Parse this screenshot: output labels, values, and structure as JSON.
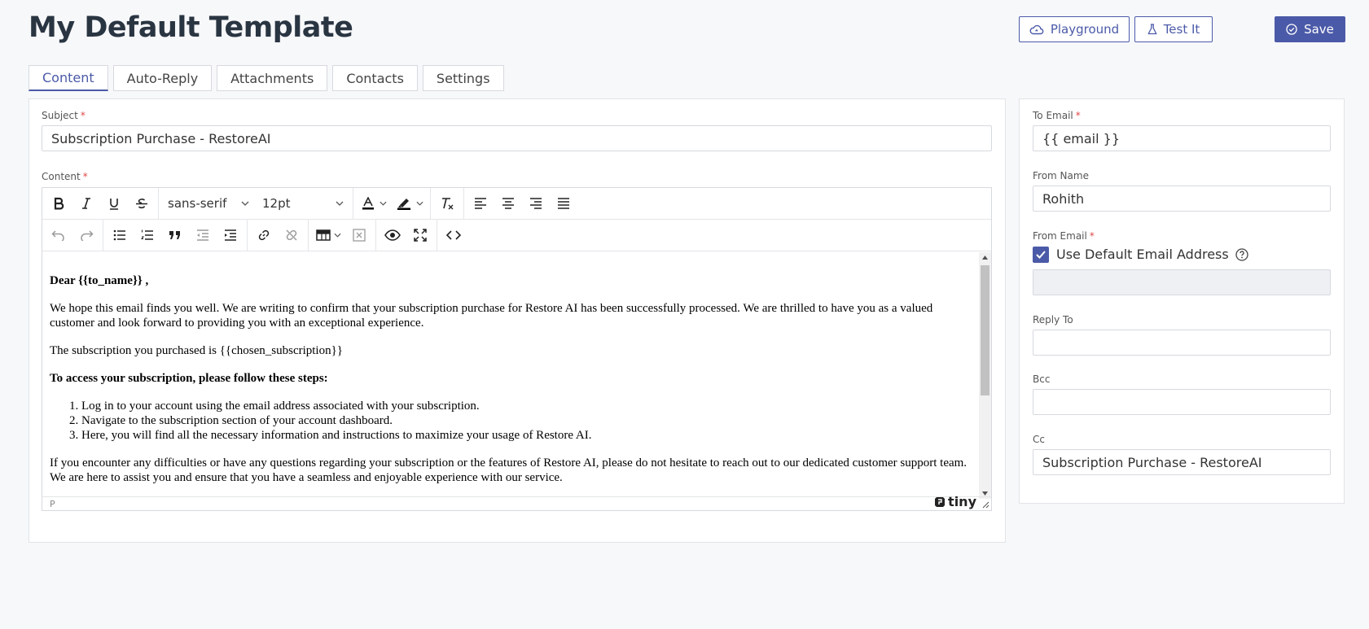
{
  "header": {
    "title": "My Default Template",
    "playground_label": "Playground",
    "test_label": "Test It",
    "save_label": "Save"
  },
  "tabs": [
    {
      "label": "Content",
      "active": true
    },
    {
      "label": "Auto-Reply"
    },
    {
      "label": "Attachments"
    },
    {
      "label": "Contacts"
    },
    {
      "label": "Settings"
    }
  ],
  "content": {
    "subject_label": "Subject",
    "subject_value": "Subscription Purchase - RestoreAI",
    "content_label": "Content"
  },
  "editor": {
    "font_family": "sans-serif",
    "font_size": "12pt",
    "status_path": "P",
    "brand": "tiny",
    "body": {
      "greeting": "Dear {{to_name}} ,",
      "para1": "We hope this email finds you well. We are writing to confirm that your subscription purchase for Restore AI has been successfully processed. We are thrilled to have you as a valued customer and look forward to providing you with an exceptional experience.",
      "para2": "The subscription you purchased is {{chosen_subscription}}",
      "steps_heading": "To access your subscription, please follow these steps:",
      "steps": [
        "Log in to your account using the email address associated with your subscription.",
        "Navigate to the subscription section of your account dashboard.",
        "Here, you will find all the necessary information and instructions to maximize your usage of Restore AI."
      ],
      "para3": "If you encounter any difficulties or have any questions regarding your subscription or the features of Restore AI, please do not hesitate to reach out to our dedicated customer support team. We are here to assist you and ensure that you have a seamless and enjoyable experience with our service."
    }
  },
  "side": {
    "to_email_label": "To Email",
    "to_email_value": "{{ email }}",
    "from_name_label": "From Name",
    "from_name_value": "Rohith",
    "from_email_label": "From Email",
    "use_default_label": "Use Default Email Address",
    "use_default_checked": true,
    "from_email_value": "",
    "reply_to_label": "Reply To",
    "reply_to_value": "",
    "bcc_label": "Bcc",
    "bcc_value": "",
    "cc_label": "Cc",
    "cc_value": "Subscription Purchase - RestoreAI"
  },
  "colors": {
    "accent": "#4b5aa8",
    "required": "#e04848"
  }
}
